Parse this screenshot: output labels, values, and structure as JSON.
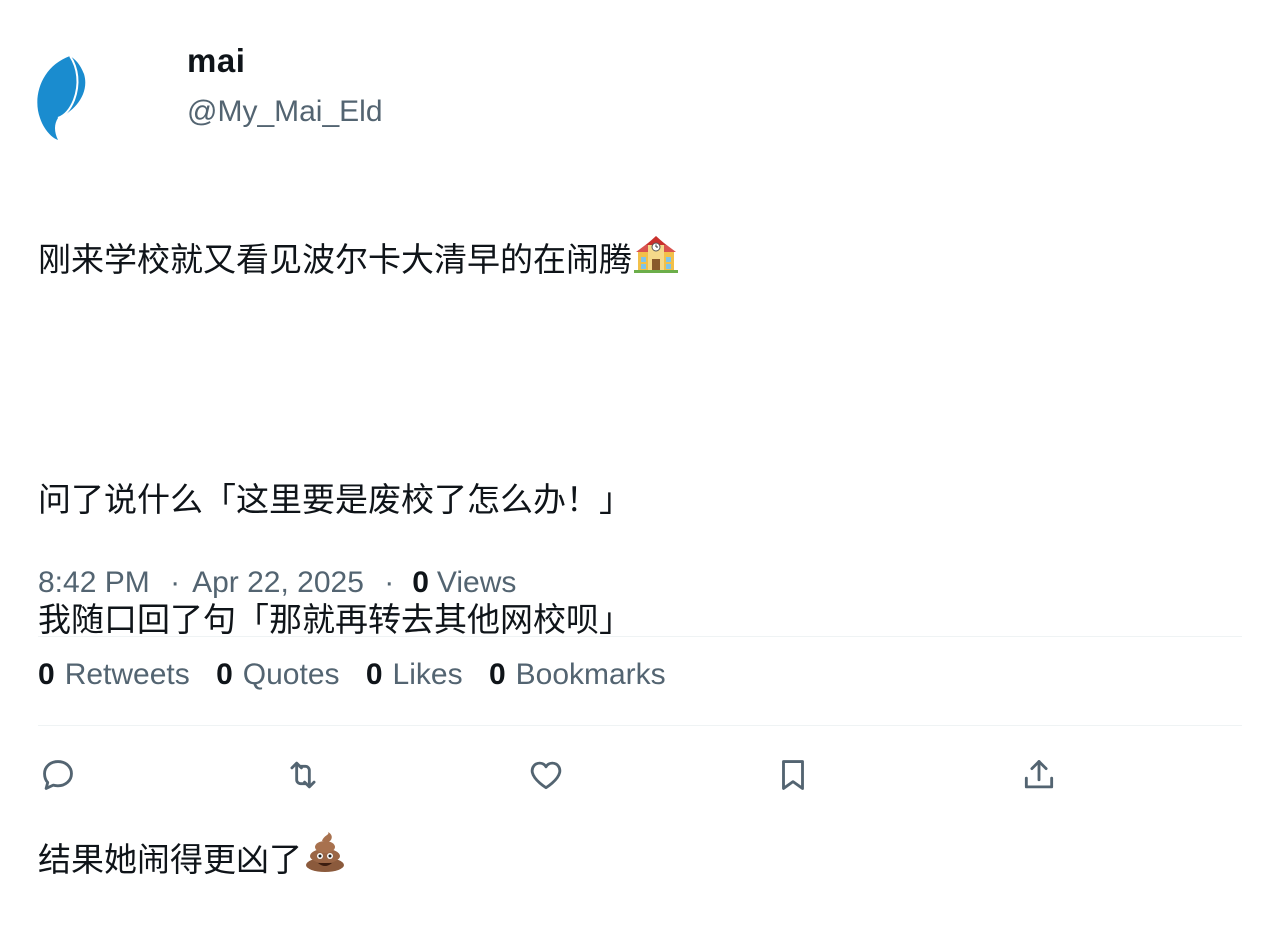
{
  "author": {
    "display_name": "mai",
    "handle": "@My_Mai_Eld",
    "avatar_icon": "blue-leaf-avatar",
    "avatar_color": "#1a8ccf"
  },
  "tweet": {
    "lines": {
      "l1": "刚来学校就又看见波尔卡大清早的在闹腾",
      "l2": "问了说什么「这里要是废校了怎么办！」",
      "l3": "我随口回了句「那就再转去其他网校呗」",
      "l4": "结果她闹得更凶了"
    },
    "emoji_1": "school-emoji",
    "emoji_2": "pile-of-poo-emoji"
  },
  "meta": {
    "time": "8:42 PM",
    "separator": "·",
    "date": "Apr 22, 2025",
    "views_count": "0",
    "views_label": "Views"
  },
  "stats": {
    "retweets": {
      "count": "0",
      "label": "Retweets"
    },
    "quotes": {
      "count": "0",
      "label": "Quotes"
    },
    "likes": {
      "count": "0",
      "label": "Likes"
    },
    "bookmarks": {
      "count": "0",
      "label": "Bookmarks"
    }
  },
  "actions": {
    "reply_icon": "reply-icon",
    "retweet_icon": "retweet-icon",
    "like_icon": "heart-icon",
    "bookmark_icon": "bookmark-icon",
    "share_icon": "share-icon"
  },
  "colors": {
    "text_primary": "#0f1419",
    "text_secondary": "#536471",
    "divider": "#eff3f4"
  }
}
